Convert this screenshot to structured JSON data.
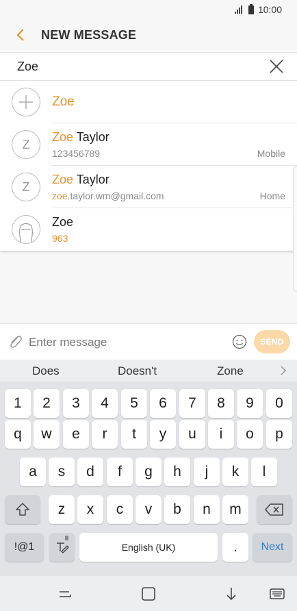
{
  "status": {
    "time": "10:00"
  },
  "header": {
    "title": "NEW MESSAGE"
  },
  "recipient": {
    "value": "Zoe"
  },
  "suggestions": [
    {
      "query": "Zoe",
      "type": "new"
    },
    {
      "initial": "Z",
      "name_match": "Zoe",
      "name_rest": " Taylor",
      "detail_match": "",
      "detail_rest": "123456789",
      "label": "Mobile"
    },
    {
      "initial": "Z",
      "name_match": "Zoe",
      "name_rest": " Taylor",
      "detail_match": "zoe",
      "detail_rest": ".taylor.wm@gmail.com",
      "label": "Home"
    },
    {
      "name": "Zoe",
      "detail": "963"
    }
  ],
  "composer": {
    "placeholder": "Enter message",
    "send_label": "SEND"
  },
  "predictions": [
    "Does",
    "Doesn't",
    "Zone"
  ],
  "keyboard": {
    "numbers": [
      "1",
      "2",
      "3",
      "4",
      "5",
      "6",
      "7",
      "8",
      "9",
      "0"
    ],
    "row1": [
      "q",
      "w",
      "e",
      "r",
      "t",
      "y",
      "u",
      "i",
      "o",
      "p"
    ],
    "row2": [
      "a",
      "s",
      "d",
      "f",
      "g",
      "h",
      "j",
      "k",
      "l"
    ],
    "row3": [
      "z",
      "x",
      "c",
      "v",
      "b",
      "n",
      "m"
    ],
    "symbols_label": "!@1",
    "space_label": "English (UK)",
    "period_label": ".",
    "next_label": "Next"
  },
  "colors": {
    "accent": "#e8912d",
    "send_disabled": "#fbd9a8",
    "keyboard_bg": "#e1e3e7"
  },
  "icons": [
    "back-arrow-icon",
    "close-icon",
    "plus-icon",
    "person-icon",
    "paperclip-icon",
    "emoji-icon",
    "chevron-right-icon",
    "shift-icon",
    "backspace-icon",
    "handwriting-icon",
    "recent-apps-icon",
    "home-icon",
    "back-icon",
    "keyboard-icon"
  ]
}
